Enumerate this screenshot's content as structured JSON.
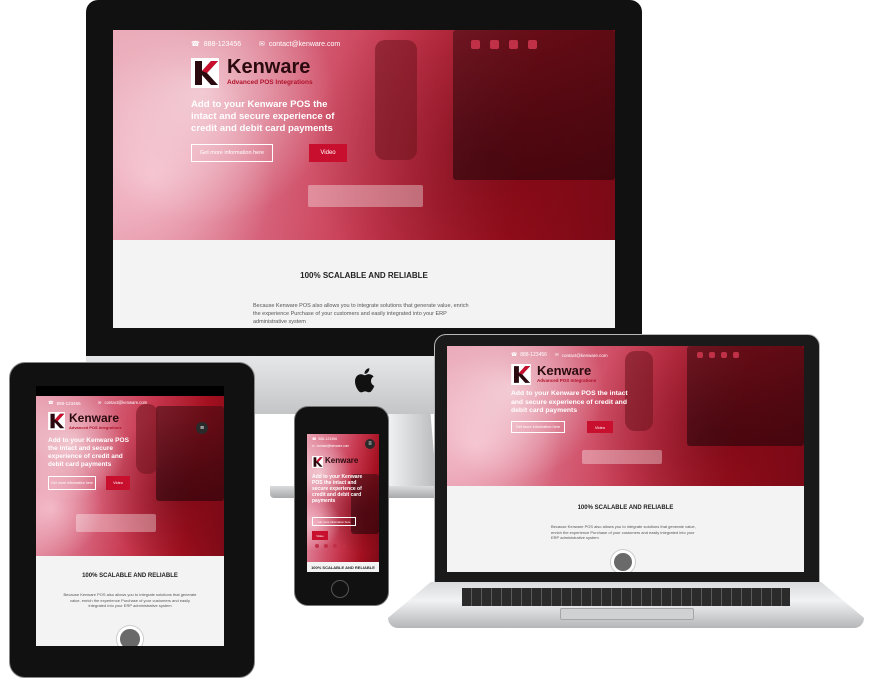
{
  "site": {
    "phone": "888-123456",
    "email": "contact@kenware.com",
    "brand": "Kenware",
    "tagline": "Advanced POS Integrations",
    "headline": "Add to your Kenware POS the intact and secure experience of credit and debit card payments",
    "cta_info": "Get more information here",
    "cta_video": "Video",
    "section_title": "100% SCALABLE AND RELIABLE",
    "section_body": "Because Kenware POS also allows you to integrate solutions that generate value, enrich the experience Purchase of your customers and easily integrated into your ERP administrative system"
  },
  "devices": [
    "desktop-monitor",
    "laptop",
    "tablet",
    "phone"
  ],
  "icons": [
    "phone-icon",
    "mail-icon",
    "facebook-icon",
    "twitter-icon",
    "google-plus-icon",
    "youtube-icon",
    "apple-logo-icon",
    "menu-icon"
  ],
  "colors": {
    "brand_red": "#c8102e",
    "brand_dark": "#2a0a0f"
  }
}
